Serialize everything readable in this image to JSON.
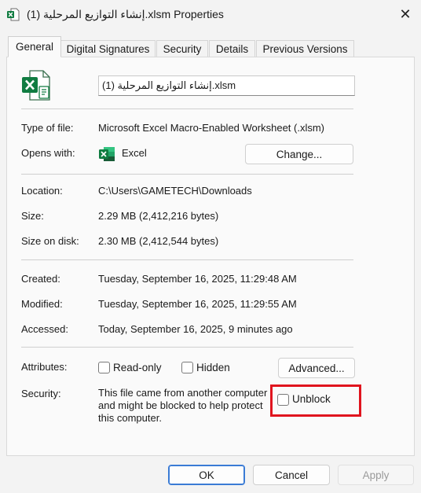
{
  "window": {
    "title": "إنشاء التوازيع المرحلية (1).xlsm Properties",
    "close_glyph": "✕"
  },
  "tabs": [
    {
      "label": "General",
      "active": true
    },
    {
      "label": "Digital Signatures",
      "active": false
    },
    {
      "label": "Security",
      "active": false
    },
    {
      "label": "Details",
      "active": false
    },
    {
      "label": "Previous Versions",
      "active": false
    }
  ],
  "file": {
    "name": "إنشاء التوازيع المرحلية (1).xlsm",
    "type_label": "Type of file:",
    "type_value": "Microsoft Excel Macro-Enabled Worksheet (.xlsm)",
    "opens_label": "Opens with:",
    "opens_value": "Excel",
    "change_button": "Change..."
  },
  "location": {
    "location_label": "Location:",
    "location_value": "C:\\Users\\GAMETECH\\Downloads",
    "size_label": "Size:",
    "size_value": "2.29 MB (2,412,216 bytes)",
    "size_disk_label": "Size on disk:",
    "size_disk_value": "2.30 MB (2,412,544 bytes)"
  },
  "dates": {
    "created_label": "Created:",
    "created_value": "Tuesday, September 16, 2025, 11:29:48 AM",
    "modified_label": "Modified:",
    "modified_value": "Tuesday, September 16, 2025, 11:29:55 AM",
    "accessed_label": "Accessed:",
    "accessed_value": "Today, September 16, 2025, 9 minutes ago"
  },
  "attributes": {
    "label": "Attributes:",
    "readonly": "Read-only",
    "hidden": "Hidden",
    "advanced_button": "Advanced..."
  },
  "security": {
    "label": "Security:",
    "line1": "This file came from another computer",
    "line2": "and might be blocked to help protect",
    "line3": "this computer.",
    "unblock": "Unblock"
  },
  "footer": {
    "ok": "OK",
    "cancel": "Cancel",
    "apply": "Apply"
  },
  "colors": {
    "excel_green": "#107c41",
    "highlight_red": "#e0141e",
    "focus_blue": "#3a7bd5"
  },
  "icons": {
    "title": "excel-file-icon",
    "file": "excel-file-icon",
    "app": "excel-app-icon",
    "close": "close-icon"
  }
}
